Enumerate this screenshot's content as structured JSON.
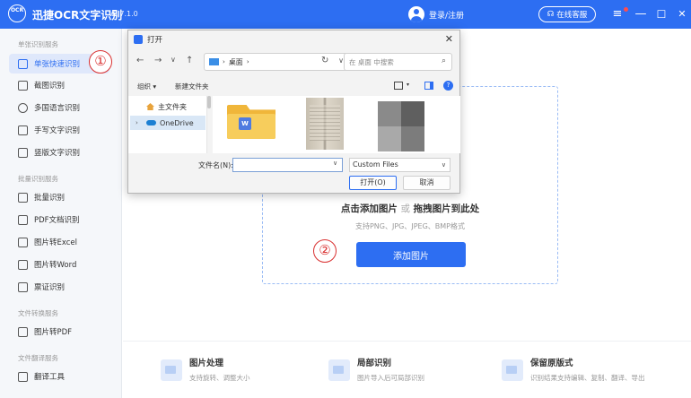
{
  "app": {
    "logo_text": "OCR",
    "name": "迅捷OCR文字识别",
    "version": "v8.7.1.0"
  },
  "header": {
    "user_label": "登录/注册",
    "service_label": "在线客服",
    "menu": "≡",
    "minimize": "—",
    "maximize": "☐",
    "close": "✕"
  },
  "sidebar": {
    "sections": [
      {
        "title": "单张识别服务",
        "items": [
          "单张快速识别",
          "截图识别",
          "多国语言识别",
          "手写文字识别",
          "竖版文字识别"
        ]
      },
      {
        "title": "批量识别服务",
        "items": [
          "批量识别",
          "PDF文档识别",
          "图片转Excel",
          "图片转Word",
          "票证识别"
        ]
      },
      {
        "title": "文件转换服务",
        "items": [
          "图片转PDF"
        ]
      },
      {
        "title": "文件翻译服务",
        "items": [
          "翻译工具"
        ]
      }
    ],
    "active_item": "单张快速识别"
  },
  "markers": {
    "first": "①",
    "second": "②"
  },
  "dropzone": {
    "title_a": "点击添加图片",
    "title_or": "或",
    "title_b": "拖拽图片到此处",
    "subtitle": "支持PNG、JPG、JPEG、BMP格式",
    "button": "添加图片"
  },
  "features": [
    {
      "title": "图片处理",
      "desc": "支持旋转、调整大小"
    },
    {
      "title": "局部识别",
      "desc": "图片导入后可局部识别"
    },
    {
      "title": "保留原版式",
      "desc": "识别结果支持编辑、复制、翻译、导出"
    }
  ],
  "dialog": {
    "title": "打开",
    "close": "✕",
    "address": "桌面",
    "search_placeholder": "在 桌面 中搜索",
    "toolbar": {
      "organize": "组织 ▾",
      "new_folder": "新建文件夹"
    },
    "nav_items": [
      "主文件夹",
      "OneDrive"
    ],
    "filename_label": "文件名(N):",
    "filename_value": "",
    "file_type": "Custom Files",
    "open_button": "打开(O)",
    "cancel_button": "取消"
  }
}
